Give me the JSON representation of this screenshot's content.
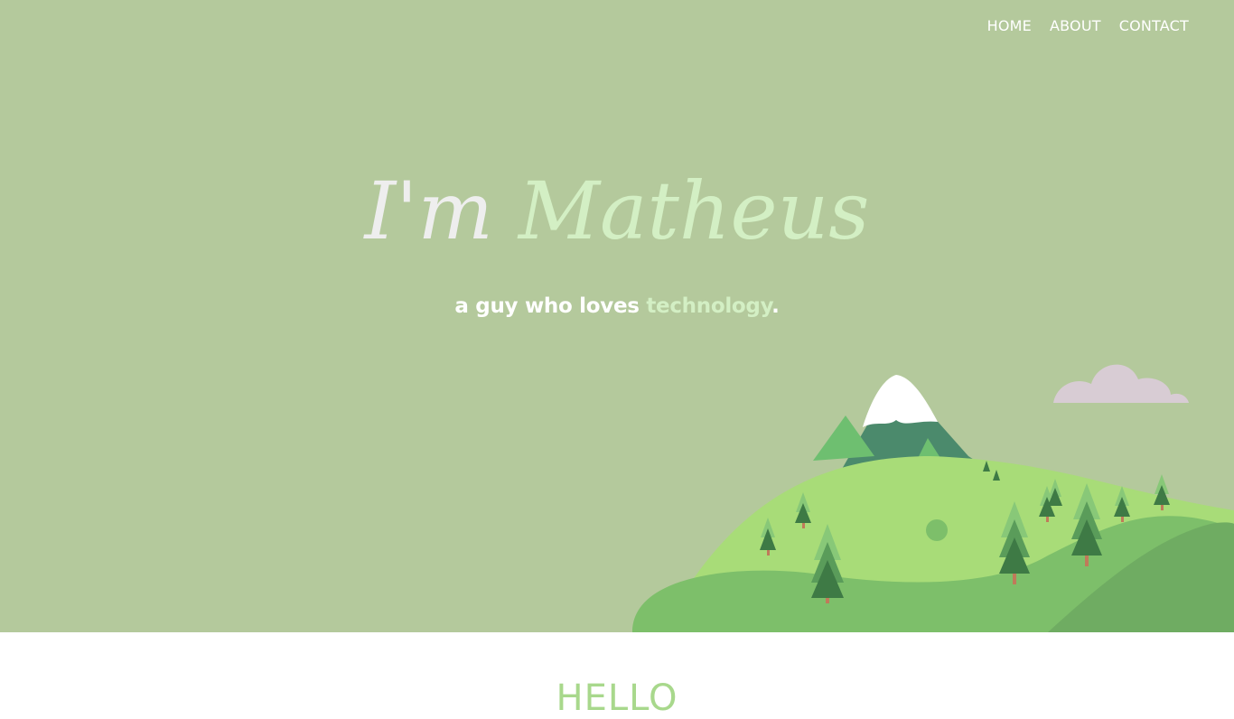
{
  "nav": {
    "home": "HOME",
    "about": "ABOUT",
    "contact": "CONTACT"
  },
  "hero": {
    "title_prefix": "I'm ",
    "title_name": "Matheus",
    "subtitle_prefix": "a guy who loves ",
    "subtitle_highlight": "technology",
    "subtitle_suffix": "."
  },
  "next_section": {
    "heading": "HELLO"
  },
  "colors": {
    "hero_background": "#b4c99c",
    "accent_light_green": "#d3efc4",
    "hello_green": "#a8d88c",
    "hill": "#a8dc78",
    "mountain": "#4b8a6c",
    "cloud": "#d8ccd4"
  }
}
